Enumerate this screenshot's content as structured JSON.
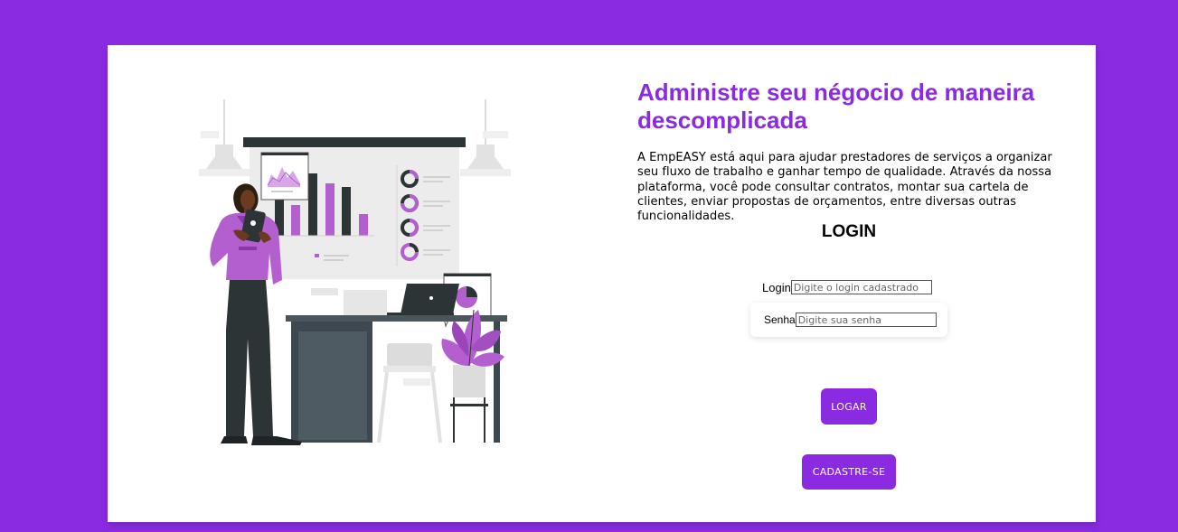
{
  "hero": {
    "headline": "Administre seu négocio de maneira descomplicada",
    "intro": "A EmpEASY está aqui para ajudar prestadores de serviços a organizar seu fluxo de trabalho e ganhar tempo de qualidade. Através da nossa plataforma, você pode consultar contratos, montar sua cartela de clientes, enviar propostas de orçamentos, entre diversas outras funcionalidades."
  },
  "login_form": {
    "title": "LOGIN",
    "login_label": "Login",
    "login_placeholder": "Digite o login cadastrado",
    "senha_label": "Senha",
    "senha_placeholder": "Digite sua senha",
    "submit_label": "LOGAR",
    "register_label": "CADASTRE-SE"
  },
  "colors": {
    "accent": "#8a2be2",
    "card": "#ffffff",
    "illustration_purple": "#b45fd0",
    "illustration_dark": "#2d3436"
  },
  "illustration": "woman-presenting-business-charts-illustration"
}
